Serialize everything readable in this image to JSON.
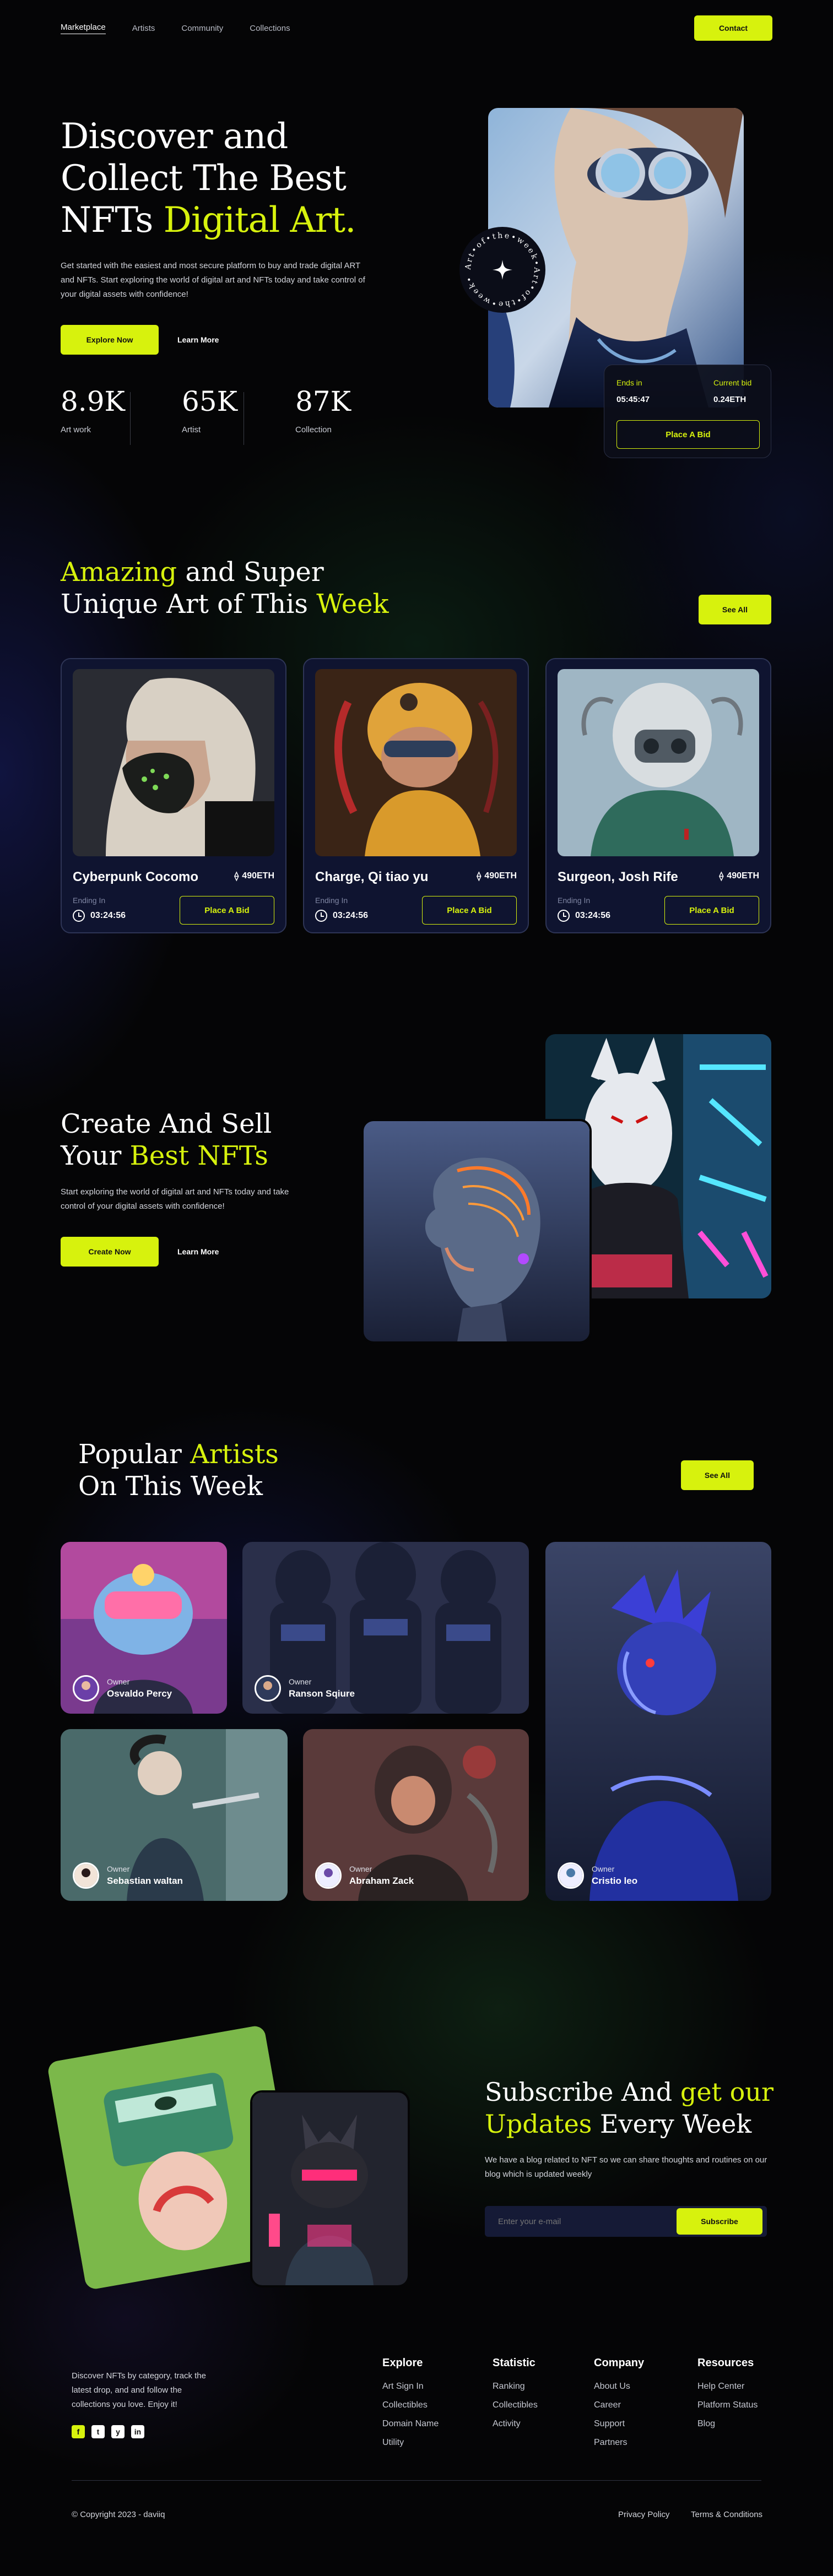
{
  "nav": {
    "items": [
      "Marketplace",
      "Artists",
      "Community",
      "Collections"
    ],
    "contact": "Contact"
  },
  "hero": {
    "line1": "Discover and",
    "line2": "Collect The Best",
    "line3a": "NFTs",
    "line3b": "Digital Art.",
    "desc": "Get started with the easiest and most secure platform to buy and trade digital ART and NFTs. Start exploring the world of digital art and NFTs today and take control of your digital assets with confidence!",
    "explore": "Explore Now",
    "learn": "Learn More",
    "badge_text": "Art•of•the•week•Art•of•the•week•",
    "stats": [
      {
        "num": "8.9K",
        "label": "Art work"
      },
      {
        "num": "65K",
        "label": "Artist"
      },
      {
        "num": "87K",
        "label": "Collection"
      }
    ],
    "bid": {
      "ends_label": "Ends in",
      "ends_value": "05:45:47",
      "current_label": "Current bid",
      "current_value": "0.24ETH",
      "button": "Place A Bid"
    }
  },
  "amazing": {
    "title_a": "Amazing",
    "title_b": "and Super",
    "title_c": "Unique Art of This",
    "title_d": "Week",
    "see_all": "See All",
    "cards": [
      {
        "title": "Cyberpunk Cocomo",
        "price": "490ETH",
        "ending": "Ending In",
        "time": "03:24:56",
        "button": "Place A Bid"
      },
      {
        "title": "Charge, Qi tiao yu",
        "price": "490ETH",
        "ending": "Ending In",
        "time": "03:24:56",
        "button": "Place A Bid"
      },
      {
        "title": "Surgeon, Josh Rife",
        "price": "490ETH",
        "ending": "Ending In",
        "time": "03:24:56",
        "button": "Place A Bid"
      }
    ]
  },
  "create": {
    "title_a": "Create And Sell",
    "title_b": "Your",
    "title_c": "Best NFTs",
    "desc": "Start exploring the world of digital art and NFTs today and take control of your digital assets with confidence!",
    "create_btn": "Create Now",
    "learn": "Learn More"
  },
  "artists": {
    "title_a": "Popular",
    "title_b": "Artists",
    "title_c": "On This Week",
    "see_all": "See All",
    "owner_label": "Owner",
    "names": [
      "Osvaldo Percy",
      "Ranson Sqiure",
      "Sebastian waltan",
      "Abraham Zack",
      "Cristio leo"
    ]
  },
  "subscribe": {
    "title_a": "Subscribe And",
    "title_b": "get our",
    "title_c": "Updates",
    "title_d": "Every Week",
    "desc": "We have a blog related to NFT so we can share thoughts and routines on our blog which is updated weekly",
    "placeholder": "Enter your e-mail",
    "button": "Subscribe"
  },
  "footer": {
    "about": "Discover NFTs by category, track the latest drop, and and follow the collections you love. Enjoy it!",
    "social": [
      "f",
      "t",
      "y",
      "in"
    ],
    "cols": [
      {
        "title": "Explore",
        "items": [
          "Art Sign In",
          "Collectibles",
          "Domain Name",
          "Utility"
        ]
      },
      {
        "title": "Statistic",
        "items": [
          "Ranking",
          "Collectibles",
          "Activity"
        ]
      },
      {
        "title": "Company",
        "items": [
          "About Us",
          "Career",
          "Support",
          "Partners"
        ]
      },
      {
        "title": "Resources",
        "items": [
          "Help Center",
          "Platform Status",
          "Blog"
        ]
      }
    ],
    "copyright": "© Copyright 2023 - daviiq",
    "privacy": "Privacy Policy",
    "terms": "Terms & Conditions"
  },
  "colors": {
    "accent": "#d7f20d",
    "bg": "#050506",
    "card": "#0f1430"
  }
}
